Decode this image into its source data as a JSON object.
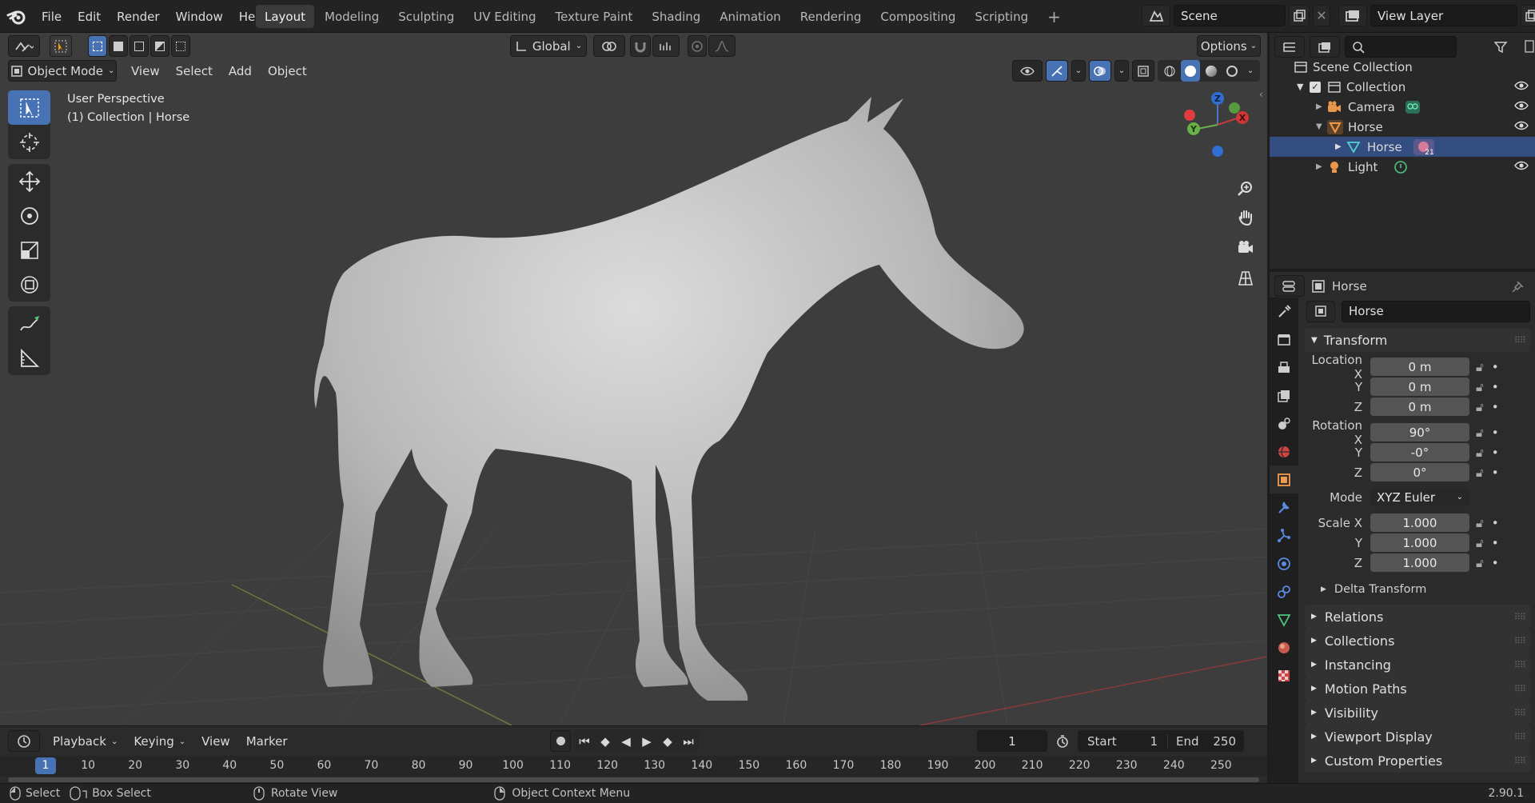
{
  "topbar": {
    "menus": [
      "File",
      "Edit",
      "Render",
      "Window",
      "Help"
    ],
    "workspaces": [
      "Layout",
      "Modeling",
      "Sculpting",
      "UV Editing",
      "Texture Paint",
      "Shading",
      "Animation",
      "Rendering",
      "Compositing",
      "Scripting"
    ],
    "active_workspace": "Layout",
    "scene": "Scene",
    "view_layer": "View Layer"
  },
  "viewport": {
    "orientation": "Global",
    "options_label": "Options",
    "mode": "Object Mode",
    "menus": [
      "View",
      "Select",
      "Add",
      "Object"
    ],
    "info_line1": "User Perspective",
    "info_line2": "(1) Collection | Horse",
    "gizmo": {
      "x": "X",
      "y": "Y",
      "z": "Z"
    }
  },
  "timeline": {
    "menus": [
      "Playback",
      "Keying",
      "View",
      "Marker"
    ],
    "current_frame": "1",
    "start_label": "Start",
    "start": "1",
    "end_label": "End",
    "end": "250",
    "ruler": [
      "1",
      "10",
      "20",
      "30",
      "40",
      "50",
      "60",
      "70",
      "80",
      "90",
      "100",
      "110",
      "120",
      "130",
      "140",
      "150",
      "160",
      "170",
      "180",
      "190",
      "200",
      "210",
      "220",
      "230",
      "240",
      "250"
    ]
  },
  "statusbar": {
    "select": "Select",
    "box_select": "Box Select",
    "rotate": "Rotate View",
    "context": "Object Context Menu",
    "version": "2.90.1"
  },
  "outliner": {
    "scene_collection": "Scene Collection",
    "collection": "Collection",
    "items": [
      "Camera",
      "Horse",
      "Horse",
      "Light"
    ],
    "badge": "21"
  },
  "properties": {
    "object_name": "Horse",
    "datablock_name": "Horse",
    "transform_label": "Transform",
    "location_label": "Location X",
    "rotation_label": "Rotation X",
    "scale_label": "Scale X",
    "y_label": "Y",
    "z_label": "Z",
    "location": [
      "0 m",
      "0 m",
      "0 m"
    ],
    "rotation": [
      "90°",
      "-0°",
      "0°"
    ],
    "mode_label": "Mode",
    "mode_value": "XYZ Euler",
    "scale": [
      "1.000",
      "1.000",
      "1.000"
    ],
    "delta": "Delta Transform",
    "panels": [
      "Relations",
      "Collections",
      "Instancing",
      "Motion Paths",
      "Visibility",
      "Viewport Display",
      "Custom Properties"
    ]
  },
  "colors": {
    "accent": "#4772b3",
    "selected_row": "#334d80",
    "viewport_bg": "#3d3d3d"
  }
}
